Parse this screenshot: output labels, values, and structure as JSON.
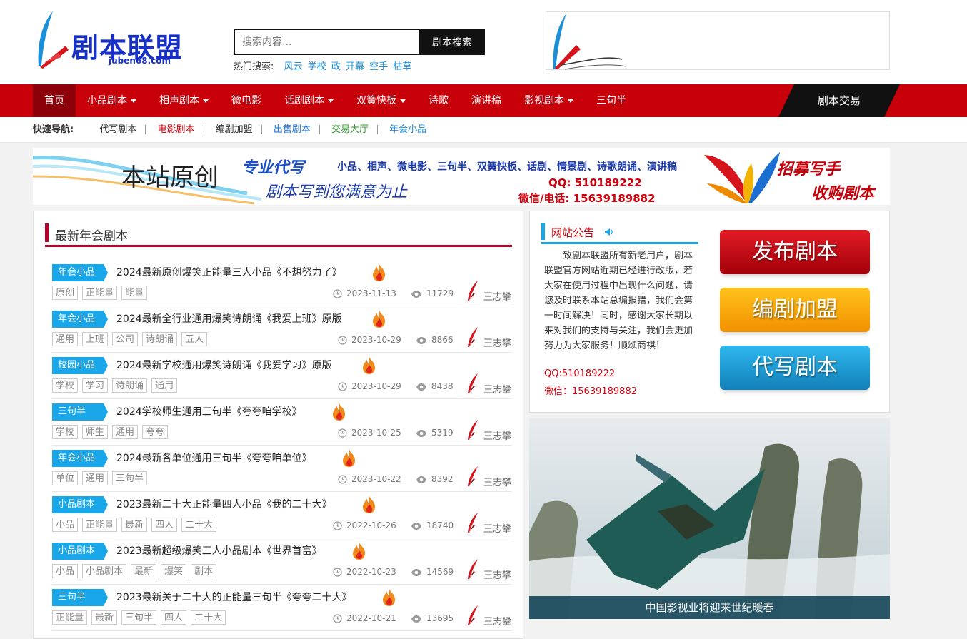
{
  "logo": {
    "name": "剧本联盟",
    "domain": "juben68.com"
  },
  "search": {
    "placeholder": "搜索内容...",
    "button": "剧本搜索",
    "hot_label": "热门搜索:",
    "hot_keywords": [
      "风云",
      "学校",
      "政",
      "开幕",
      "空手",
      "枯草"
    ]
  },
  "nav": {
    "items": [
      {
        "label": "首页",
        "dropdown": false
      },
      {
        "label": "小品剧本",
        "dropdown": true
      },
      {
        "label": "相声剧本",
        "dropdown": true
      },
      {
        "label": "微电影",
        "dropdown": false
      },
      {
        "label": "话剧剧本",
        "dropdown": true
      },
      {
        "label": "双簧快板",
        "dropdown": true
      },
      {
        "label": "诗歌",
        "dropdown": false
      },
      {
        "label": "演讲稿",
        "dropdown": false
      },
      {
        "label": "影视剧本",
        "dropdown": true
      },
      {
        "label": "三句半",
        "dropdown": false
      }
    ],
    "trade": "剧本交易"
  },
  "quick": {
    "label": "快速导航:",
    "links": [
      {
        "label": "代写剧本",
        "color": "#333333"
      },
      {
        "label": "电影剧本",
        "color": "#d0000c"
      },
      {
        "label": "编剧加盟",
        "color": "#333333"
      },
      {
        "label": "出售剧本",
        "color": "#1b6fd0"
      },
      {
        "label": "交易大厅",
        "color": "#2e9a2e"
      },
      {
        "label": "年会小品",
        "color": "#1b8fd7"
      }
    ]
  },
  "banner": {
    "original": "本站原创",
    "pro": "专业代写",
    "types": "小品、相声、微电影、三句半、双簧快板、话剧、情景剧、诗歌朗诵、演讲稿",
    "slogan": "剧本写到您满意为止",
    "qq": "QQ: 510189222",
    "phone": "微信/电话: 15639189882",
    "recruit": "招募写手",
    "buy": "收购剧本"
  },
  "section": {
    "title": "最新年会剧本"
  },
  "articles": [
    {
      "cat": "年会小品",
      "title": "2024最新原创爆笑正能量三人小品《不想努力了》",
      "tags": [
        "原创",
        "正能量",
        "能量"
      ],
      "date": "2023-11-13",
      "views": "11729",
      "author": "王志攀"
    },
    {
      "cat": "年会小品",
      "title": "2024最新全行业通用爆笑诗朗诵《我爱上班》原版",
      "tags": [
        "通用",
        "上班",
        "公司",
        "诗朗诵",
        "五人"
      ],
      "date": "2023-10-29",
      "views": "8866",
      "author": "王志攀"
    },
    {
      "cat": "校园小品",
      "title": "2024最新学校通用爆笑诗朗诵《我爱学习》原版",
      "tags": [
        "学校",
        "学习",
        "诗朗诵",
        "通用"
      ],
      "date": "2023-10-29",
      "views": "8438",
      "author": "王志攀"
    },
    {
      "cat": "三句半",
      "title": "2024学校师生通用三句半《夸夸咱学校》",
      "tags": [
        "学校",
        "师生",
        "通用",
        "夸夸"
      ],
      "date": "2023-10-25",
      "views": "5319",
      "author": "王志攀"
    },
    {
      "cat": "年会小品",
      "title": "2024最新各单位通用三句半《夸夸咱单位》",
      "tags": [
        "单位",
        "通用",
        "三句半"
      ],
      "date": "2023-10-22",
      "views": "8392",
      "author": "王志攀"
    },
    {
      "cat": "小品剧本",
      "title": "2023最新二十大正能量四人小品《我的二十大》",
      "tags": [
        "小品",
        "正能量",
        "最新",
        "四人",
        "二十大"
      ],
      "date": "2022-10-26",
      "views": "18740",
      "author": "王志攀"
    },
    {
      "cat": "小品剧本",
      "title": "2023最新超级爆笑三人小品剧本《世界首富》",
      "tags": [
        "小品",
        "小品剧本",
        "最新",
        "爆笑",
        "剧本"
      ],
      "date": "2022-10-23",
      "views": "14569",
      "author": "王志攀"
    },
    {
      "cat": "三句半",
      "title": "2023最新关于二十大的正能量三句半《夸夸二十大》",
      "tags": [
        "正能量",
        "最新",
        "三句半",
        "四人",
        "二十大"
      ],
      "date": "2022-10-21",
      "views": "13695",
      "author": "王志攀"
    }
  ],
  "notice": {
    "title": "网站公告",
    "text": "致剧本联盟所有新老用户，剧本联盟官方网站近期已经进行改版，若大家在使用过程中出现什么问题，请您及时联系本站总编报错，我们会第一时间解决！同时，感谢大家长期以来对我们的支持与关注，我们会更加努力为大家服务！顺颂商祺！",
    "qq": "QQ:510189222",
    "wechat": "微信：15639189882"
  },
  "buttons": {
    "publish": "发布剧本",
    "join": "编剧加盟",
    "write": "代写剧本"
  },
  "photo": {
    "caption": "中国影视业将迎来世纪暖春"
  }
}
